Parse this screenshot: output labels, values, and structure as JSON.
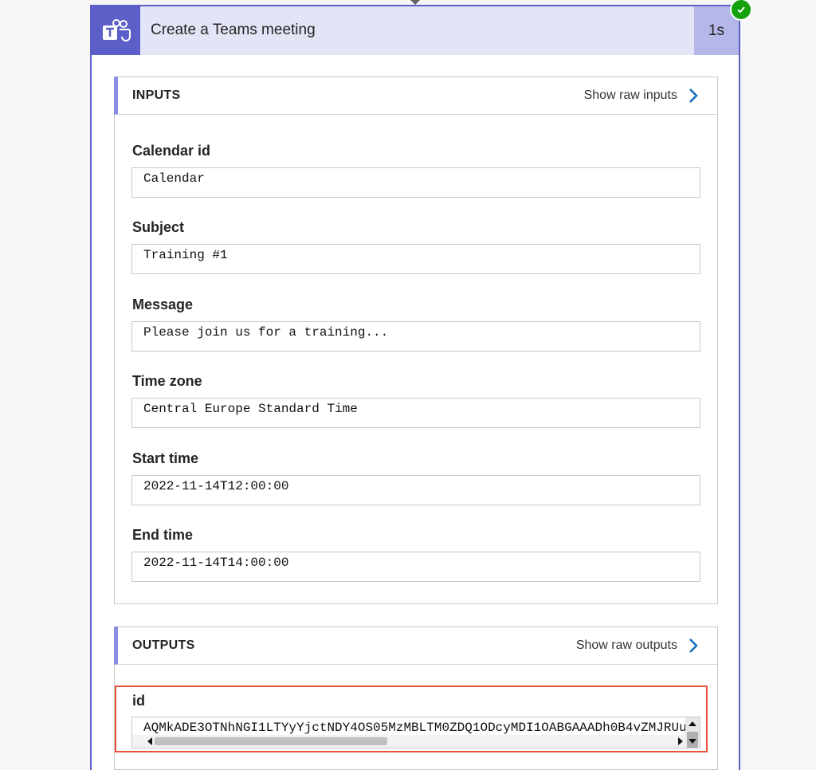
{
  "card": {
    "title": "Create a Teams meeting",
    "duration": "1s",
    "status": "succeeded"
  },
  "inputs": {
    "section_label": "INPUTS",
    "raw_link": "Show raw inputs",
    "fields": [
      {
        "label": "Calendar id",
        "value": "Calendar"
      },
      {
        "label": "Subject",
        "value": "Training #1"
      },
      {
        "label": "Message",
        "value": "Please join us for a training..."
      },
      {
        "label": "Time zone",
        "value": "Central Europe Standard Time"
      },
      {
        "label": "Start time",
        "value": "2022-11-14T12:00:00"
      },
      {
        "label": "End time",
        "value": "2022-11-14T14:00:00"
      }
    ]
  },
  "outputs": {
    "section_label": "OUTPUTS",
    "raw_link": "Show raw outputs",
    "fields": [
      {
        "label": "id",
        "value": "AQMkADE3OTNhNGI1LTYyYjctNDY4OS05MzMBLTM0ZDQ1ODcyMDI1OABGAAADh0B4vZMJRUu"
      }
    ]
  },
  "colors": {
    "accent": "#5b5fc7",
    "header_bg": "#e3e4f6",
    "success": "#13a10e",
    "highlight": "#e8543a",
    "link_chevron": "#0f6cbd"
  },
  "icons": {
    "app": "teams-icon",
    "status": "checkmark-icon",
    "raw_link": "chevron-right-icon"
  }
}
